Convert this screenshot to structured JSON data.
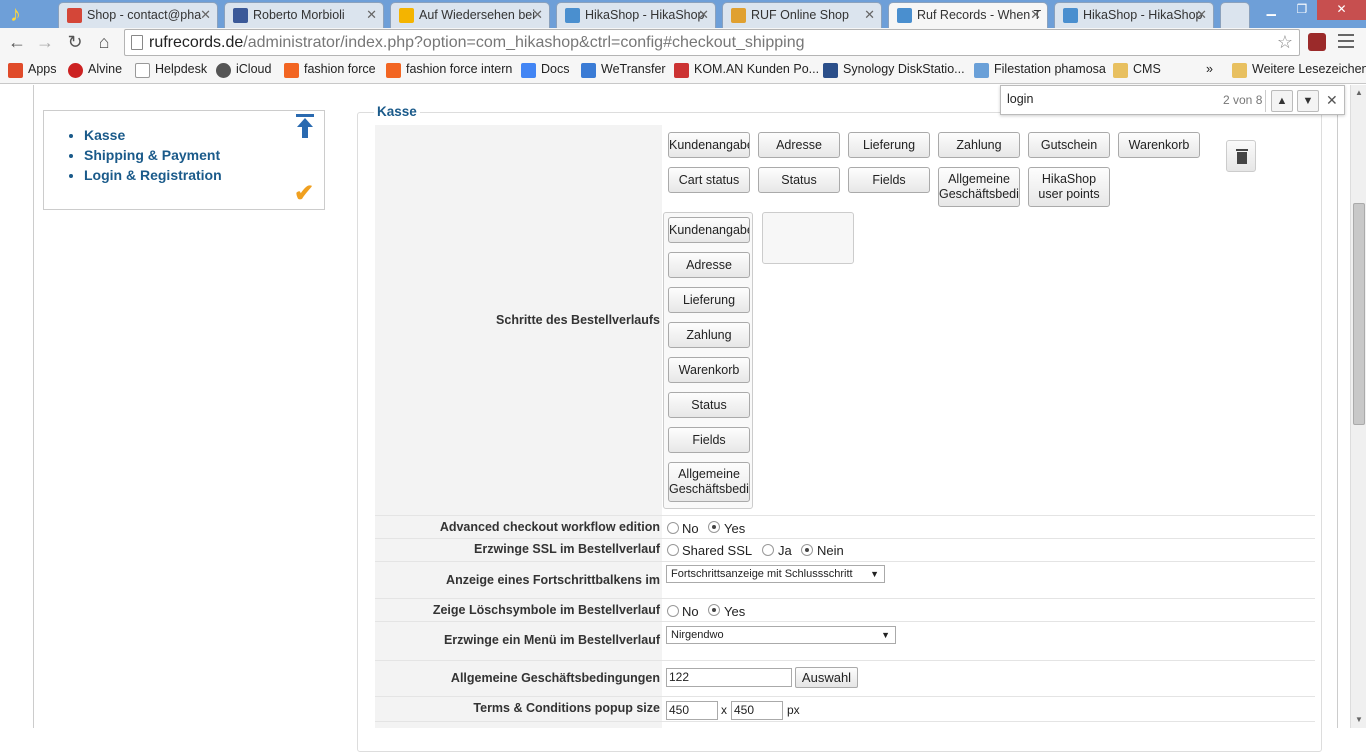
{
  "browser": {
    "tabs": [
      {
        "label": "Shop - contact@pha",
        "favicon_color": "#d44638"
      },
      {
        "label": "Roberto Morbioli",
        "favicon_color": "#3b5998"
      },
      {
        "label": "Auf Wiedersehen bei",
        "favicon_color": "#f4b400"
      },
      {
        "label": "HikaShop - HikaShop",
        "favicon_color": "#4a8fcf"
      },
      {
        "label": "RUF Online Shop",
        "favicon_color": "#e0a030"
      },
      {
        "label": "Ruf Records - When T",
        "favicon_color": "#4a8fcf"
      },
      {
        "label": "HikaShop - HikaShop",
        "favicon_color": "#4a8fcf"
      }
    ],
    "url_host": "rufrecords.de",
    "url_path": "/administrator/index.php?option=com_hikashop&ctrl=config#checkout_shipping",
    "bookmarks": [
      {
        "label": "Apps",
        "icon_color": "#e04b2a"
      },
      {
        "label": "Alvine",
        "icon_color": "#cc2222"
      },
      {
        "label": "Helpdesk",
        "icon_color": "#ffffff"
      },
      {
        "label": "iCloud",
        "icon_color": "#555555"
      },
      {
        "label": "fashion force",
        "icon_color": "#f26522"
      },
      {
        "label": "fashion force intern",
        "icon_color": "#f26522"
      },
      {
        "label": "Docs",
        "icon_color": "#4285f4"
      },
      {
        "label": "WeTransfer",
        "icon_color": "#3a7bd5"
      },
      {
        "label": "KOM.AN Kunden Po...",
        "icon_color": "#cc3333"
      },
      {
        "label": "Synology DiskStatio...",
        "icon_color": "#2b4f8a"
      },
      {
        "label": "Filestation phamosa",
        "icon_color": "#6aa0d8"
      },
      {
        "label": "CMS",
        "icon_color": "#e8c060"
      }
    ],
    "bookmarks_overflow": "»",
    "other_bookmarks": "Weitere Lesezeichen"
  },
  "find": {
    "query": "login",
    "count": "2 von 8"
  },
  "sidebar": {
    "items": [
      "Kasse",
      "Shipping & Payment",
      "Login & Registration"
    ]
  },
  "section": {
    "legend": "Kasse",
    "steps_label": "Schritte des Bestellverlaufs",
    "available_steps": [
      "Kundenangaben",
      "Adresse",
      "Lieferung",
      "Zahlung",
      "Gutschein",
      "Warenkorb",
      "Cart status",
      "Status",
      "Fields",
      "Allgemeine Geschäftsbedingungen",
      "HikaShop user points"
    ],
    "workflow_steps": [
      "Kundenangaben",
      "Adresse",
      "Lieferung",
      "Zahlung",
      "Warenkorb",
      "Status",
      "Fields",
      "Allgemeine Geschäftsbedingungen"
    ]
  },
  "settings": {
    "advanced_label": "Advanced checkout workflow edition",
    "advanced_no": "No",
    "advanced_yes": "Yes",
    "ssl_label": "Erzwinge SSL im Bestellverlauf",
    "ssl_shared": "Shared SSL",
    "ssl_ja": "Ja",
    "ssl_nein": "Nein",
    "progress_label": "Anzeige eines Fortschrittbalkens im Bestellverlauf",
    "progress_value": "Fortschrittsanzeige mit Schlussschritt",
    "delete_label": "Zeige Löschsymbole im Bestellverlauf",
    "delete_no": "No",
    "delete_yes": "Yes",
    "menu_label": "Erzwinge ein Menü im Bestellverlauf",
    "menu_value": "Nirgendwo",
    "terms_label": "Allgemeine Geschäftsbedingungen",
    "terms_value": "122",
    "terms_button": "Auswahl",
    "popup_label": "Terms & Conditions popup size",
    "popup_w": "450",
    "popup_x": "x",
    "popup_h": "450",
    "popup_unit": "px"
  }
}
